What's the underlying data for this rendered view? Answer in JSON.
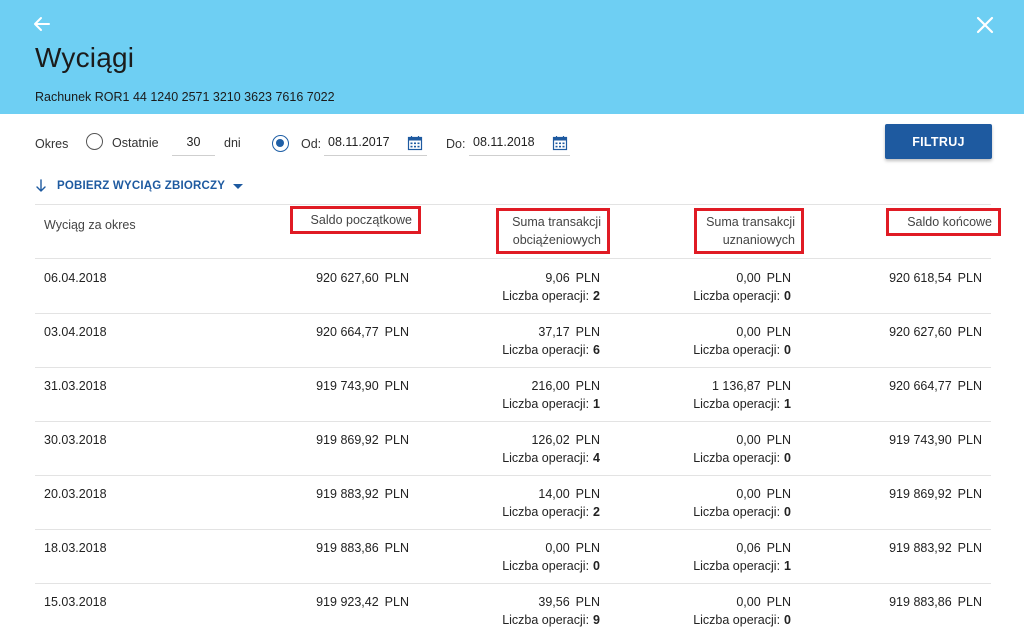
{
  "header": {
    "title": "Wyciągi",
    "account": "Rachunek ROR1 44 1240 2571 3210 3623 7616 7022"
  },
  "filter": {
    "period_label": "Okres",
    "last_label": "Ostatnie",
    "last_value": "30",
    "days_label": "dni",
    "from_label": "Od:",
    "from_value": "08.11.2017",
    "to_label": "Do:",
    "to_value": "08.11.2018",
    "button_label": "FILTRUJ"
  },
  "download": {
    "label": "POBIERZ WYCIĄG ZBIORCZY"
  },
  "table": {
    "headers": {
      "period": "Wyciąg za okres",
      "opening": "Saldo początkowe",
      "debit_1": "Suma transakcji",
      "debit_2": "obciążeniowych",
      "credit_1": "Suma transakcji",
      "credit_2": "uznaniowych",
      "closing": "Saldo końcowe"
    },
    "currency": "PLN",
    "ops_label": "Liczba operacji:",
    "rows": [
      {
        "date": "06.04.2018",
        "opening": "920 627,60",
        "debit": "9,06",
        "debit_ops": "2",
        "credit": "0,00",
        "credit_ops": "0",
        "closing": "920 618,54"
      },
      {
        "date": "03.04.2018",
        "opening": "920 664,77",
        "debit": "37,17",
        "debit_ops": "6",
        "credit": "0,00",
        "credit_ops": "0",
        "closing": "920 627,60"
      },
      {
        "date": "31.03.2018",
        "opening": "919 743,90",
        "debit": "216,00",
        "debit_ops": "1",
        "credit": "1 136,87",
        "credit_ops": "1",
        "closing": "920 664,77"
      },
      {
        "date": "30.03.2018",
        "opening": "919 869,92",
        "debit": "126,02",
        "debit_ops": "4",
        "credit": "0,00",
        "credit_ops": "0",
        "closing": "919 743,90"
      },
      {
        "date": "20.03.2018",
        "opening": "919 883,92",
        "debit": "14,00",
        "debit_ops": "2",
        "credit": "0,00",
        "credit_ops": "0",
        "closing": "919 869,92"
      },
      {
        "date": "18.03.2018",
        "opening": "919 883,86",
        "debit": "0,00",
        "debit_ops": "0",
        "credit": "0,06",
        "credit_ops": "1",
        "closing": "919 883,92"
      },
      {
        "date": "15.03.2018",
        "opening": "919 923,42",
        "debit": "39,56",
        "debit_ops": "9",
        "credit": "0,00",
        "credit_ops": "0",
        "closing": "919 883,86"
      }
    ]
  },
  "icons": {
    "back": "arrow-left-icon",
    "close": "close-icon",
    "calendar": "calendar-icon",
    "download": "download-arrow-icon",
    "dropdown": "caret-down-icon"
  },
  "colors": {
    "header_bg": "#6ecff3",
    "accent": "#1e5aa0",
    "highlight": "#e01b24"
  }
}
